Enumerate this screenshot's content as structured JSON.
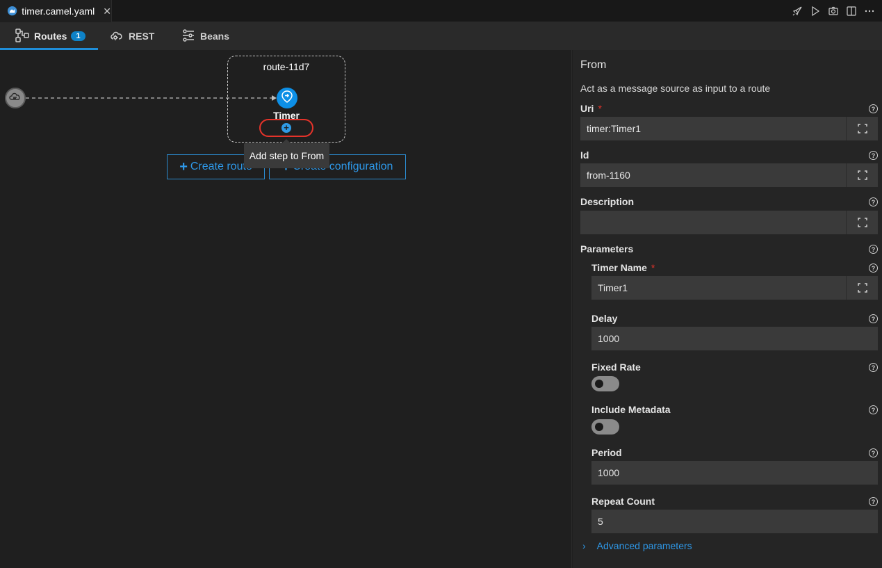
{
  "file_tab": {
    "name": "timer.camel.yaml",
    "close": "✕"
  },
  "title_actions": [
    "rocket-icon",
    "run-icon",
    "camera-icon",
    "split-editor-icon",
    "more-icon"
  ],
  "tabs": [
    {
      "label": "Routes",
      "badge": "1",
      "icon": "routes-icon"
    },
    {
      "label": "REST",
      "icon": "cloud-icon"
    },
    {
      "label": "Beans",
      "icon": "beans-icon"
    }
  ],
  "canvas": {
    "route_label": "route-11d7",
    "node_label": "Timer",
    "tooltip": "Add step to From",
    "create_route": "Create route",
    "create_configuration": "Create configuration",
    "plus": "+"
  },
  "panel": {
    "title": "From",
    "description": "Act as a message source as input to a route",
    "uri": {
      "label": "Uri",
      "required": "*",
      "value": "timer:Timer1"
    },
    "id": {
      "label": "Id",
      "value": "from-1160"
    },
    "description_field": {
      "label": "Description",
      "value": ""
    },
    "parameters_label": "Parameters",
    "timer_name": {
      "label": "Timer Name",
      "required": "*",
      "value": "Timer1"
    },
    "delay": {
      "label": "Delay",
      "value": "1000"
    },
    "fixed_rate": {
      "label": "Fixed Rate",
      "on": false
    },
    "include_metadata": {
      "label": "Include Metadata",
      "on": false
    },
    "period": {
      "label": "Period",
      "value": "1000"
    },
    "repeat_count": {
      "label": "Repeat Count",
      "value": "5"
    },
    "advanced": "Advanced parameters",
    "help": "?"
  },
  "colors": {
    "accent": "#1f8ed9",
    "required": "#e5332a",
    "highlight": "#e5332a"
  }
}
